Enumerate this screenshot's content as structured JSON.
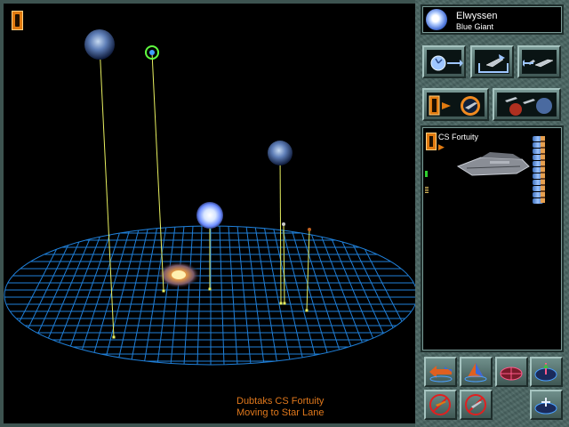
{
  "star": {
    "name": "Elwyssen",
    "class": "Blue Giant"
  },
  "ship": {
    "name": "CS Fortuity",
    "cargo_slots": 11
  },
  "status": {
    "line1": "Dubtaks CS Fortuity",
    "line2": "Moving to Star Lane"
  },
  "colors": {
    "grid": "#1f7fd8",
    "beam": "#e8f060",
    "status_text": "#e0781c",
    "accent_orange": "#e07a10"
  },
  "icons": {
    "view_corner": "hourglass-icon",
    "star": "blue-giant-star-icon",
    "actions": [
      "galaxy-move-icon",
      "launch-ship-icon",
      "fleet-ships-icon",
      "attack-orbit-icon",
      "planets-and-ships-icon"
    ],
    "bottom": [
      "left-right-arrows-icon",
      "up-arrow-grid-icon",
      "red-grid-icon",
      "ship-grid-icon",
      "cancel-orbit-icon",
      "cancel-ship-icon",
      "add-grid-icon"
    ]
  }
}
